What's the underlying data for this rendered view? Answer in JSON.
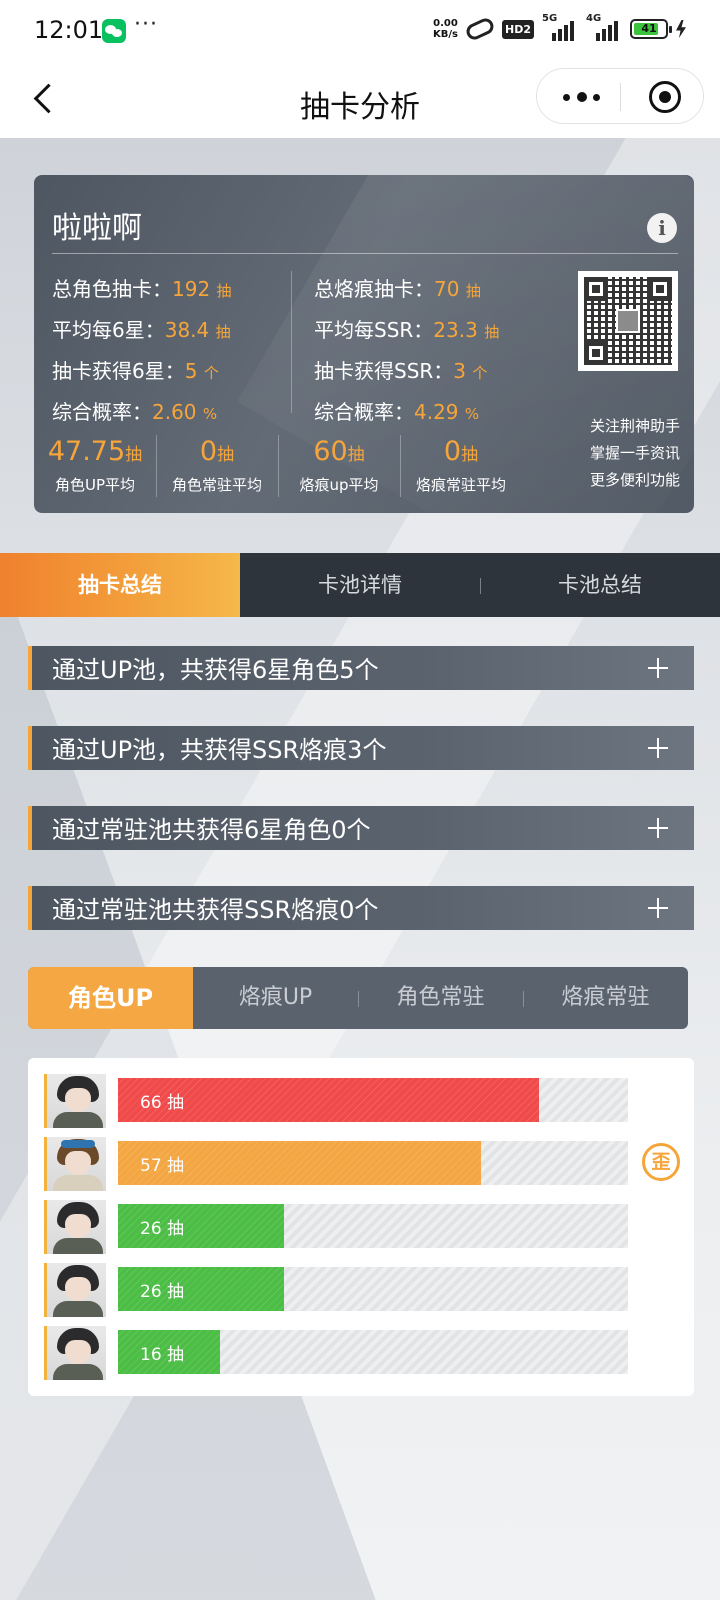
{
  "status_bar": {
    "time": "12:01",
    "speed_top": "0.00",
    "speed_bottom": "KB/s",
    "hd": "HD2",
    "net1": "5G",
    "net2": "4G",
    "battery": "41"
  },
  "nav": {
    "title": "抽卡分析"
  },
  "stats": {
    "user": "啦啦啊",
    "left": [
      {
        "label": "总角色抽卡：",
        "value": "192",
        "unit": "抽"
      },
      {
        "label": "平均每6星：",
        "value": "38.4",
        "unit": "抽"
      },
      {
        "label": "抽卡获得6星：",
        "value": "5",
        "unit": "个"
      },
      {
        "label": "综合概率：",
        "value": "2.60",
        "unit": "%"
      }
    ],
    "right": [
      {
        "label": "总烙痕抽卡：",
        "value": "70",
        "unit": "抽"
      },
      {
        "label": "平均每SSR：",
        "value": "23.3",
        "unit": "抽"
      },
      {
        "label": "抽卡获得SSR：",
        "value": "3",
        "unit": "个"
      },
      {
        "label": "综合概率：",
        "value": "4.29",
        "unit": "%"
      }
    ],
    "averages": [
      {
        "value": "47.75",
        "unit": "抽",
        "label": "角色UP平均"
      },
      {
        "value": "0",
        "unit": "抽",
        "label": "角色常驻平均"
      },
      {
        "value": "60",
        "unit": "抽",
        "label": "烙痕up平均"
      },
      {
        "value": "0",
        "unit": "抽",
        "label": "烙痕常驻平均"
      }
    ],
    "promo": [
      "关注荆神助手",
      "掌握一手资讯",
      "更多便利功能"
    ]
  },
  "main_tabs": [
    "抽卡总结",
    "卡池详情",
    "卡池总结"
  ],
  "summaries": [
    "通过UP池，共获得6星角色5个",
    "通过UP池，共获得SSR烙痕3个",
    "通过常驻池共获得6星角色0个",
    "通过常驻池共获得SSR烙痕0个"
  ],
  "sub_tabs": [
    "角色UP",
    "烙痕UP",
    "角色常驻",
    "烙痕常驻"
  ],
  "records": [
    {
      "label": "66 抽",
      "pulls": 66,
      "max": 80,
      "color": "#f04a4a",
      "badge": ""
    },
    {
      "label": "57 抽",
      "pulls": 57,
      "max": 80,
      "color": "#f3a642",
      "badge": "歪"
    },
    {
      "label": "26 抽",
      "pulls": 26,
      "max": 80,
      "color": "#4cbe45",
      "badge": ""
    },
    {
      "label": "26 抽",
      "pulls": 26,
      "max": 80,
      "color": "#4cbe45",
      "badge": ""
    },
    {
      "label": "16 抽",
      "pulls": 16,
      "max": 80,
      "color": "#4cbe45",
      "badge": ""
    }
  ]
}
